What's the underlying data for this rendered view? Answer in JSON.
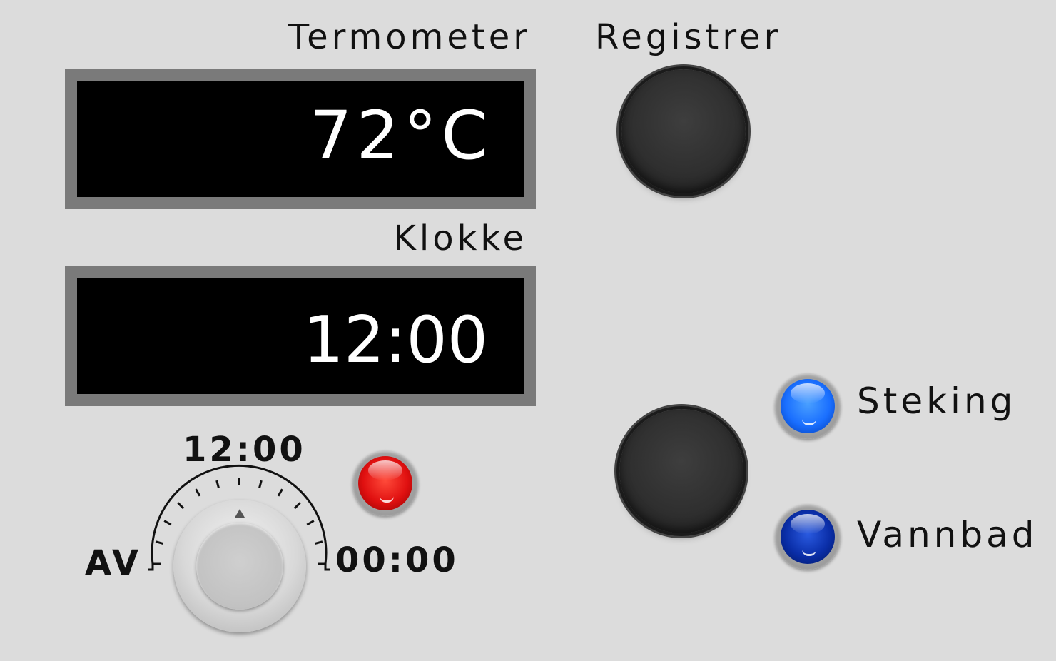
{
  "thermometer": {
    "label": "Termometer",
    "value": "72°C"
  },
  "clock": {
    "label": "Klokke",
    "value": "12:00"
  },
  "register": {
    "label": "Registrer"
  },
  "timer_dial": {
    "max_label": "12:00",
    "off_label": "AV",
    "min_label": "00:00"
  },
  "indicators": {
    "timer": {
      "color": "#e01010"
    },
    "steking": {
      "label": "Steking",
      "color": "#1a6fff",
      "state": "on"
    },
    "vannbad": {
      "label": "Vannbad",
      "color": "#0a2ea8",
      "state": "off"
    }
  },
  "icons": {
    "register_button": "round-button",
    "mode_button": "round-button",
    "dial_pointer": "triangle-up-icon"
  }
}
